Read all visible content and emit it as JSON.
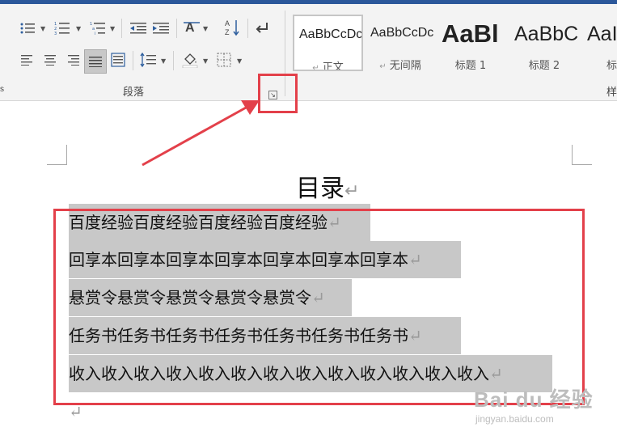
{
  "ribbon": {
    "paragraph_group_label": "段落",
    "styles_group_label_partial": "样",
    "left_cut_label": "s",
    "launcher_glyph": "↘",
    "styles": [
      {
        "sample": "AaBbCcDc",
        "name": "正文",
        "pilcrow": "↵",
        "active": true
      },
      {
        "sample": "AaBbCcDc",
        "name": "无间隔",
        "pilcrow": "↵",
        "active": false
      },
      {
        "sample": "AaBl",
        "name": "标题 1",
        "pilcrow": "",
        "active": false
      },
      {
        "sample": "AaBbC",
        "name": "标题 2",
        "pilcrow": "",
        "active": false
      },
      {
        "sample": "AaI",
        "name": "标",
        "pilcrow": "",
        "active": false
      }
    ]
  },
  "document": {
    "title": "目录",
    "paragraph_mark": "↵",
    "lines": [
      "百度经验百度经验百度经验百度经验",
      "回享本回享本回享本回享本回享本回享本回享本",
      "悬赏令悬赏令悬赏令悬赏令悬赏令",
      "任务书任务书任务书任务书任务书任务书任务书",
      "收入收入收入收入收入收入收入收入收入收入收入收入收入"
    ]
  },
  "watermark": {
    "brand": "Bai du 经验",
    "sub": "jingyan.baidu.com"
  },
  "colors": {
    "ribbon_bg": "#f3f3f3",
    "title_bar": "#2b579a",
    "selection_highlight": "#c8c8c8",
    "annotation_red": "#e3404a"
  }
}
